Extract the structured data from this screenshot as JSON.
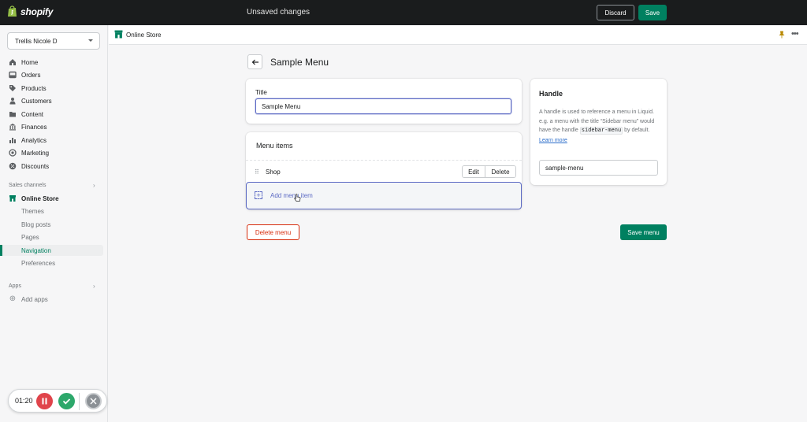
{
  "topbar": {
    "brand": "shopify",
    "status": "Unsaved changes",
    "discard_label": "Discard",
    "save_label": "Save"
  },
  "sidebar": {
    "store_name": "Trellis Nicole D",
    "items": [
      {
        "label": "Home",
        "icon": "home-icon"
      },
      {
        "label": "Orders",
        "icon": "orders-icon"
      },
      {
        "label": "Products",
        "icon": "tag-icon"
      },
      {
        "label": "Customers",
        "icon": "person-icon"
      },
      {
        "label": "Content",
        "icon": "folder-icon"
      },
      {
        "label": "Finances",
        "icon": "bank-icon"
      },
      {
        "label": "Analytics",
        "icon": "bar-chart-icon"
      },
      {
        "label": "Marketing",
        "icon": "target-icon"
      },
      {
        "label": "Discounts",
        "icon": "discount-icon"
      }
    ],
    "sales_channels_label": "Sales channels",
    "online_store_label": "Online Store",
    "online_store_sub": [
      "Themes",
      "Blog posts",
      "Pages",
      "Navigation",
      "Preferences"
    ],
    "active_sub": "Navigation",
    "apps_label": "Apps",
    "add_apps_label": "Add apps"
  },
  "recorder": {
    "time": "01:20"
  },
  "header": {
    "title": "Online Store"
  },
  "page": {
    "title": "Sample Menu",
    "title_field_label": "Title",
    "title_value": "Sample Menu",
    "menu_items_heading": "Menu items",
    "menu_items": [
      {
        "label": "Shop"
      }
    ],
    "edit_label": "Edit",
    "delete_label": "Delete",
    "add_item_label": "Add menu item",
    "handle": {
      "heading": "Handle",
      "desc_1": "A handle is used to reference a menu in Liquid. e.g. a menu with the title “Sidebar menu” would have the handle",
      "code": "sidebar-menu",
      "desc_2": "by default.",
      "learn_more": "Learn more",
      "value": "sample-menu"
    },
    "delete_menu_label": "Delete menu",
    "save_menu_label": "Save menu"
  },
  "colors": {
    "topbar": "#1a1c1d",
    "primary": "#008060",
    "critical": "#d72c0d",
    "focus": "#5c6ac4"
  }
}
